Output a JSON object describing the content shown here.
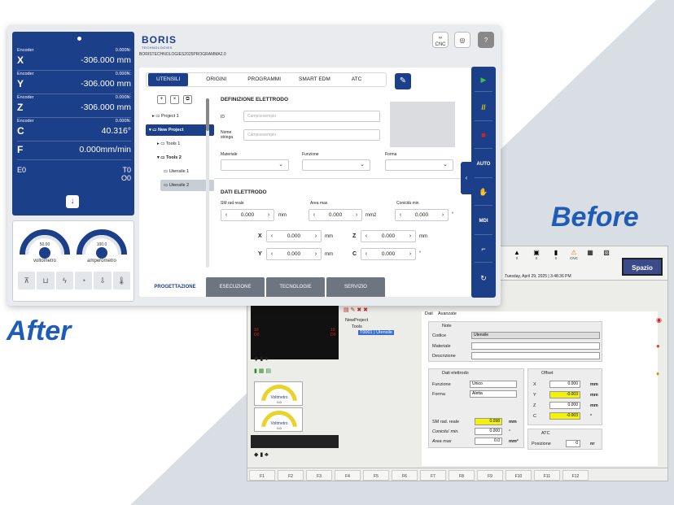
{
  "labels": {
    "after": "After",
    "before": "Before"
  },
  "encoder": {
    "rows": [
      {
        "lab": "Encoder",
        "sm": "0.000N:",
        "ax": "X",
        "val": "-306.000 mm"
      },
      {
        "lab": "Encoder",
        "sm": "0.000N:",
        "ax": "Y",
        "val": "-306.000 mm"
      },
      {
        "lab": "Encoder",
        "sm": "0.000N:",
        "ax": "Z",
        "val": "-306.000 mm"
      },
      {
        "lab": "Encoder",
        "sm": "0.000N:",
        "ax": "C",
        "val": "40.316°"
      },
      {
        "lab": "",
        "sm": "",
        "ax": "F",
        "val": "0.000mm/min"
      }
    ],
    "e0": "E0",
    "t0": "T0",
    "o0": "O0"
  },
  "gauges": [
    {
      "num": "50.00",
      "label": "voltometro"
    },
    {
      "num": "100.0",
      "label": "amperometro"
    }
  ],
  "topbar": {
    "logo": "BORIS",
    "logo_sub": "TECHNOLOGIES",
    "path": "BORISTECHNOLOGIES2025PROGRAMMA2.0",
    "cnc": "CNC",
    "help": "?"
  },
  "tabs": [
    "UTENSILI",
    "ORIGINI",
    "PROGRAMMI",
    "SMART EDM",
    "ATC"
  ],
  "tree": {
    "items": [
      "Project 1",
      "New Project",
      "Tools 1",
      "Tools 2",
      "Utensile 1",
      "Utensile 2"
    ]
  },
  "def": {
    "title": "DEFINIZIONE ELETTRODO",
    "id_label": "ID",
    "id_ph": "Campoesempio",
    "nome_label": "Nome stringa",
    "nome_ph": "Campoesempio",
    "materiale": "Materiale",
    "funzione": "Funzione",
    "forma": "Forma"
  },
  "dati": {
    "title": "DATI ELETTRODO",
    "sm_label": "SM rad reale",
    "sm_val": "0.000",
    "sm_unit": "mm",
    "area_label": "Area max",
    "area_val": "0.000",
    "area_unit": "mm2",
    "con_label": "Conicità min",
    "con_val": "0.000",
    "con_unit": "°",
    "x_val": "0.000",
    "y_val": "0.000",
    "z_val": "0.000",
    "c_val": "0.000",
    "mm": "mm",
    "deg": "°"
  },
  "btabs": [
    "PROGETTAZIONE",
    "ESECUZIONE",
    "TECNOLOGIE",
    "SERVIZIO"
  ],
  "rside": {
    "auto": "AUTO",
    "mdi": "MDI"
  },
  "before": {
    "date": "Tuesday, April 29, 2025",
    "time": "3:48:36 PM",
    "spazio": "Spazio",
    "icons": [
      {
        "n": "0"
      },
      {
        "n": "0"
      },
      {
        "n": "0"
      },
      {
        "n": "CNC"
      }
    ],
    "tree": [
      "NewProject",
      "Tools",
      "T0001 | Utensile"
    ],
    "tabs": [
      "Dati",
      "Avanzate"
    ],
    "note": "Note",
    "codice": "Codice",
    "codice_val": "Utensile",
    "materiale": "Materiale",
    "descrizione": "Descrizione",
    "dati_el": "Dati elettrodo",
    "funzione": "Funzione",
    "funzione_val": "Unico",
    "forma": "Forma",
    "forma_val": "Aletta",
    "offset": "Offset",
    "off": [
      {
        "k": "X",
        "v": "0.000",
        "u": "mm"
      },
      {
        "k": "Y",
        "v": "-0.003",
        "u": "mm"
      },
      {
        "k": "Z",
        "v": "0.000",
        "u": "mm"
      },
      {
        "k": "C",
        "v": "-0.003",
        "u": "°"
      }
    ],
    "sm": "SM rad. reale",
    "sm_val": "0.098",
    "sm_u": "mm",
    "con": "Conicita' min.",
    "con_val": "0.000",
    "con_u": "°",
    "area": "Area max",
    "area_val": "0.0",
    "area_u": "mm²",
    "atc": "ATC",
    "posizione": "Posizione",
    "pos_val": "0",
    "pos_u": "nr",
    "volt1": "Voltmetro",
    "volt1v": "0.0",
    "volt2": "Voltmetro",
    "volt2v": "0.0",
    "fkeys": [
      "F1",
      "F2",
      "F3",
      "F4",
      "F5",
      "F6",
      "F7",
      "F8",
      "F9",
      "F10",
      "F11",
      "F12"
    ]
  }
}
